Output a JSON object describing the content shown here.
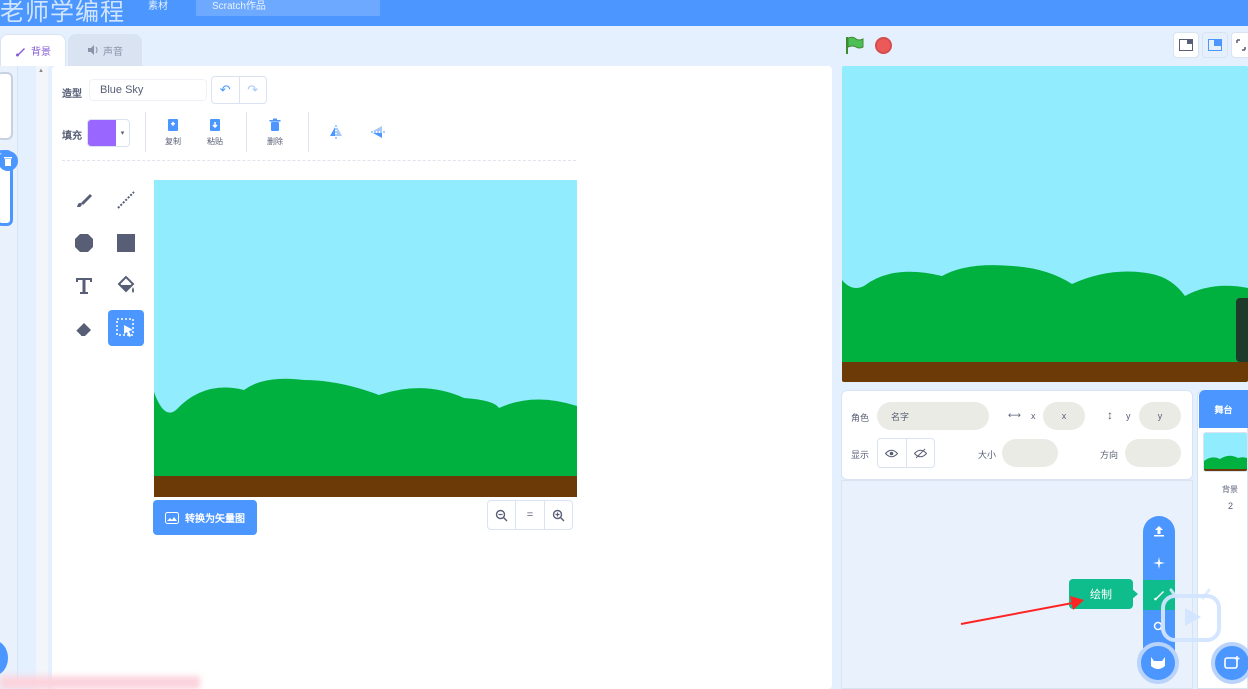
{
  "watermark": {
    "title": "老师学编程",
    "item1": "素材",
    "item2": "Scratch作品"
  },
  "tabs": {
    "backdrops": "背景",
    "sounds": "声音"
  },
  "editor": {
    "costume_label": "造型",
    "costume_name": "Blue Sky",
    "fill_label": "填充",
    "fill_color": "#9966ff",
    "copy_label": "复制",
    "paste_label": "粘贴",
    "delete_label": "删除",
    "convert_button": "转换为矢量图",
    "zoom_reset": "="
  },
  "sprite_info": {
    "sprite_label": "角色",
    "name_placeholder": "名字",
    "x_label": "x",
    "x_placeholder": "x",
    "y_label": "y",
    "y_placeholder": "y",
    "show_label": "显示",
    "size_label": "大小",
    "direction_label": "方向"
  },
  "stage_selector": {
    "header": "舞台",
    "backdrops_label": "背景",
    "backdrops_count": "2"
  },
  "sprite_menu": {
    "tooltip": "绘制"
  },
  "colors": {
    "accent": "#4c97ff",
    "sky": "#91ecfd",
    "grass": "#00b140",
    "ground": "#6b3a06",
    "paint_green": "#0fbd8c",
    "stop_red": "#ec5959"
  }
}
